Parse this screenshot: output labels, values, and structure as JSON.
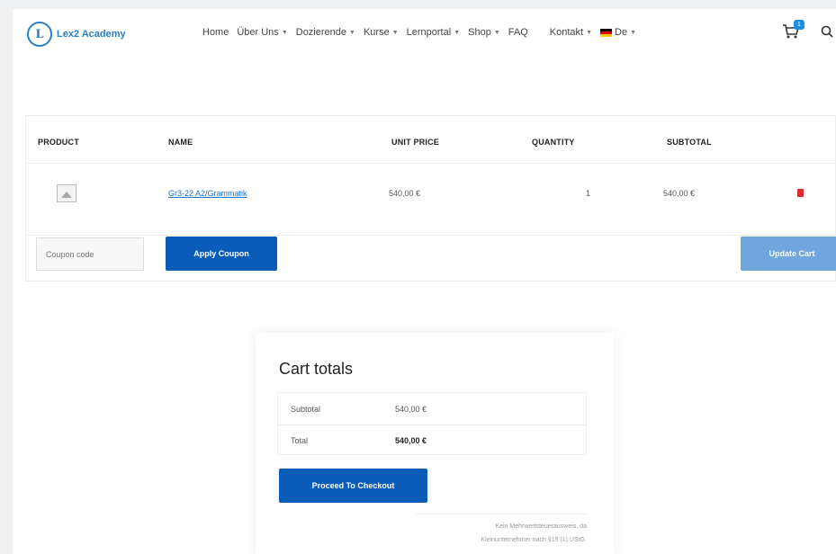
{
  "header": {
    "logo_mark": "L",
    "logo_text": "Lex2 Academy",
    "nav": [
      {
        "label": "Home",
        "dropdown": false
      },
      {
        "label": "Über Uns",
        "dropdown": true
      },
      {
        "label": "Dozierende",
        "dropdown": true
      },
      {
        "label": "Kurse",
        "dropdown": true
      },
      {
        "label": "Lernportal",
        "dropdown": true
      },
      {
        "label": "Shop",
        "dropdown": true
      },
      {
        "label": "FAQ",
        "dropdown": false
      },
      {
        "label": "Kontakt",
        "dropdown": true
      }
    ],
    "language": "De",
    "cart_count": "1"
  },
  "cart": {
    "columns": {
      "product": "PRODUCT",
      "name": "NAME",
      "unit_price": "UNIT PRICE",
      "quantity": "QUANTITY",
      "subtotal": "SUBTOTAL"
    },
    "items": [
      {
        "name": "Gr3-22 A2/Grammatik",
        "unit_price": "540,00 €",
        "quantity": "1",
        "subtotal": "540,00 €"
      }
    ],
    "coupon_placeholder": "Coupon code",
    "apply_label": "Apply Coupon",
    "update_label": "Update Cart"
  },
  "totals": {
    "title": "Cart totals",
    "subtotal_label": "Subtotal",
    "subtotal_value": "540,00 €",
    "total_label": "Total",
    "total_value": "540,00 €",
    "checkout_label": "Proceed To Checkout",
    "note_line1": "Kein Mehrwertsteuerausweis, da",
    "note_line2": "Kleinunternehmer nach §19 (1) UStG."
  },
  "colors": {
    "primary_button": "#0b5cb8",
    "update_button": "#6fa6de",
    "link": "#1a73c9",
    "remove_icon": "#e0282e"
  }
}
